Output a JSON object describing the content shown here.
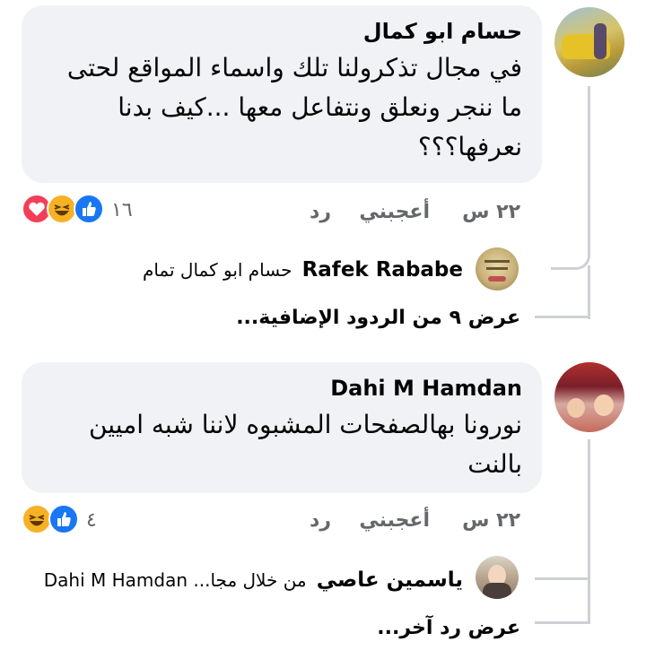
{
  "comments": [
    {
      "author": "حسام ابو كمال",
      "text": "في مجال تذكرولنا تلك واسماء المواقع  لحتى ما ننجر ونعلق ونتفاعل معها ...كيف بدنا نعرفها؟؟؟",
      "time": "٢٢ س",
      "like_label": "أعجبني",
      "reply_label": "رد",
      "reaction_count": "١٦",
      "reactions": [
        "like-icon",
        "haha-icon",
        "love-icon"
      ],
      "reply": {
        "author": "Rafek Rababe",
        "text": "حسام ابو كمال تمام"
      },
      "more_replies": "عرض ٩ من الردود الإضافية..."
    },
    {
      "author": "Dahi M Hamdan",
      "text": "نورونا بهالصفحات المشبوه لاننا شبه اميين بالنت",
      "time": "٢٢ س",
      "like_label": "أعجبني",
      "reply_label": "رد",
      "reaction_count": "٤",
      "reactions": [
        "like-icon",
        "haha-icon"
      ],
      "reply": {
        "author": "ياسمين عاصي",
        "text": "من خلال مجا... Dahi M Hamdan"
      },
      "more_replies": "عرض رد آخر..."
    }
  ],
  "colors": {
    "bubble": "#f0f2f5",
    "like": "#1877f2",
    "love": "#f33e58",
    "haha": "#f7b125",
    "meta": "#65676b"
  }
}
